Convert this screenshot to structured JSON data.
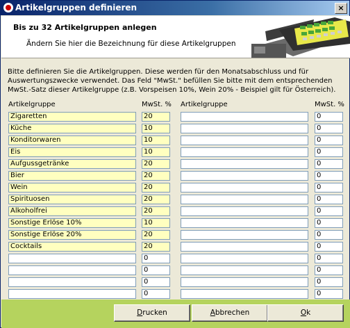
{
  "window": {
    "title": "Artikelgruppen definieren",
    "close_glyph": "×"
  },
  "header": {
    "title": "Bis zu 32 Artikelgruppen anlegen",
    "subtitle": "Ändern Sie hier die Bezeichnung für diese Artikelgruppen"
  },
  "description": "Bitte definieren Sie die Artikelgruppen. Diese werden für den Monatsabschluss und für Auswertungszwecke verwendet. Das Feld \"MwSt.\" befüllen Sie bitte mit dem entsprechenden MwSt.-Satz dieser Artikelgruppe (z.B. Vorspeisen 10%, Wein 20% - Beispiel gilt für Österreich).",
  "columns": {
    "left_group": "Artikelgruppe",
    "left_vat": "MwSt. %",
    "right_group": "Artikelgruppe",
    "right_vat": "MwSt. %"
  },
  "left_rows": [
    {
      "name": "Zigaretten",
      "vat": "20"
    },
    {
      "name": "Küche",
      "vat": "10"
    },
    {
      "name": "Konditorwaren",
      "vat": "10"
    },
    {
      "name": "Eis",
      "vat": "10"
    },
    {
      "name": "Aufgussgetränke",
      "vat": "20"
    },
    {
      "name": "Bier",
      "vat": "20"
    },
    {
      "name": "Wein",
      "vat": "20"
    },
    {
      "name": "Spirituosen",
      "vat": "20"
    },
    {
      "name": "Alkoholfrei",
      "vat": "20"
    },
    {
      "name": "Sonstige Erlöse 10%",
      "vat": "10"
    },
    {
      "name": "Sonstige Erlöse 20%",
      "vat": "20"
    },
    {
      "name": "Cocktails",
      "vat": "20"
    },
    {
      "name": "",
      "vat": "0"
    },
    {
      "name": "",
      "vat": "0"
    },
    {
      "name": "",
      "vat": "0"
    },
    {
      "name": "",
      "vat": "0"
    }
  ],
  "right_rows": [
    {
      "name": "",
      "vat": "0"
    },
    {
      "name": "",
      "vat": "0"
    },
    {
      "name": "",
      "vat": "0"
    },
    {
      "name": "",
      "vat": "0"
    },
    {
      "name": "",
      "vat": "0"
    },
    {
      "name": "",
      "vat": "0"
    },
    {
      "name": "",
      "vat": "0"
    },
    {
      "name": "",
      "vat": "0"
    },
    {
      "name": "",
      "vat": "0"
    },
    {
      "name": "",
      "vat": "0"
    },
    {
      "name": "",
      "vat": "0"
    },
    {
      "name": "",
      "vat": "0"
    },
    {
      "name": "",
      "vat": "0"
    },
    {
      "name": "",
      "vat": "0"
    },
    {
      "name": "",
      "vat": "0"
    },
    {
      "name": "",
      "vat": "0"
    }
  ],
  "buttons": {
    "print": {
      "mnemonic": "D",
      "rest": "rucken"
    },
    "cancel": {
      "mnemonic": "A",
      "rest": "bbrechen"
    },
    "ok": {
      "mnemonic": "O",
      "rest": "k"
    }
  },
  "colors": {
    "filled_field": "#ffffc0",
    "footer": "#b5d35e",
    "title_start": "#0a246a"
  }
}
